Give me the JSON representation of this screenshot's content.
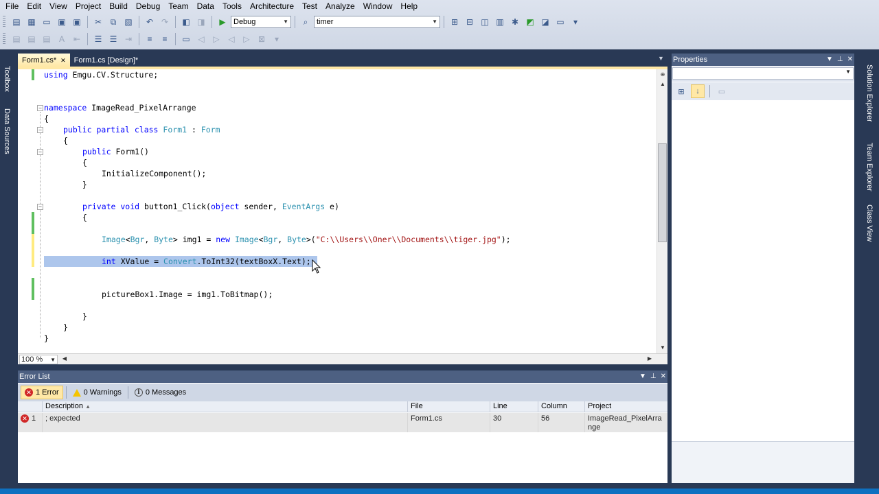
{
  "menu": [
    "File",
    "Edit",
    "View",
    "Project",
    "Build",
    "Debug",
    "Team",
    "Data",
    "Tools",
    "Architecture",
    "Test",
    "Analyze",
    "Window",
    "Help"
  ],
  "toolbar": {
    "config_value": "Debug",
    "find_value": "timer"
  },
  "left_tabs": [
    "Toolbox",
    "Data Sources"
  ],
  "right_tabs": [
    "Solution Explorer",
    "Team Explorer",
    "Class View"
  ],
  "tabs": [
    {
      "label": "Form1.cs*",
      "active": true
    },
    {
      "label": "Form1.cs [Design]*",
      "active": false
    }
  ],
  "code": {
    "l1_kw": "using",
    "l1_rest": " Emgu.CV.Structure;",
    "l2_kw": "namespace",
    "l2_rest": " ImageRead_PixelArrange",
    "brace_open": "{",
    "brace_close": "}",
    "l3_kw": "public partial class",
    "l3_type": "Form1",
    "l3_colon": " : ",
    "l3_base": "Form",
    "l4_kw": "public",
    "l4_rest": " Form1()",
    "l5": "InitializeComponent();",
    "l6_kw": "private void",
    "l6_mid": " button1_Click(",
    "l6_kw2": "object",
    "l6_mid2": " sender, ",
    "l6_type": "EventArgs",
    "l6_end": " e)",
    "l7_t1": "Image",
    "l7_lt": "<",
    "l7_t2": "Bgr",
    "l7_comma": ", ",
    "l7_t3": "Byte",
    "l7_mid": "> img1 = ",
    "l7_kw": "new",
    "l7_sp": " ",
    "l7_t4": "Image",
    "l7_t5": "Bgr",
    "l7_t6": "Byte",
    "l7_paren": ">(",
    "l7_str": "\"C:\\\\Users\\\\Oner\\\\Documents\\\\tiger.jpg\"",
    "l7_end": ");",
    "l8_kw": "int",
    "l8_mid": " XValue = ",
    "l8_type": "Convert",
    "l8_end": ".ToInt32(textBoxX.Text);",
    "l9": "pictureBox1.Image = img1.ToBitmap();"
  },
  "zoom": "100 %",
  "properties": {
    "title": "Properties"
  },
  "error_list": {
    "title": "Error List",
    "filters": {
      "errors": "1 Error",
      "warnings": "0 Warnings",
      "messages": "0 Messages"
    },
    "columns": [
      "Description",
      "File",
      "Line",
      "Column",
      "Project"
    ],
    "rows": [
      {
        "num": "1",
        "description": "; expected",
        "file": "Form1.cs",
        "line": "30",
        "column": "56",
        "project": "ImageRead_PixelArrange"
      }
    ]
  },
  "colors": {
    "keyword": "#0000ff",
    "type": "#2b91af",
    "string": "#a31515",
    "selection": "#adc6ec",
    "change_saved": "#5fbf5f",
    "change_unsaved": "#ffeb80",
    "chrome_dark": "#293955"
  }
}
